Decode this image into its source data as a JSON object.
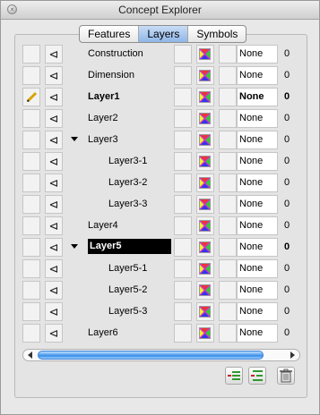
{
  "window": {
    "title": "Concept Explorer",
    "close_glyph": "×"
  },
  "tabs": [
    {
      "label": "Features",
      "active": false
    },
    {
      "label": "Layers",
      "active": true
    },
    {
      "label": "Symbols",
      "active": false
    }
  ],
  "layers": [
    {
      "name": "Construction",
      "indent": 0,
      "bold": false,
      "selected": false,
      "current": false,
      "expanded": null,
      "linetype": "None",
      "count": "0"
    },
    {
      "name": "Dimension",
      "indent": 0,
      "bold": false,
      "selected": false,
      "current": false,
      "expanded": null,
      "linetype": "None",
      "count": "0"
    },
    {
      "name": "Layer1",
      "indent": 0,
      "bold": true,
      "selected": false,
      "current": true,
      "expanded": null,
      "linetype": "None",
      "count": "0"
    },
    {
      "name": "Layer2",
      "indent": 0,
      "bold": false,
      "selected": false,
      "current": false,
      "expanded": null,
      "linetype": "None",
      "count": "0"
    },
    {
      "name": "Layer3",
      "indent": 0,
      "bold": false,
      "selected": false,
      "current": false,
      "expanded": true,
      "linetype": "None",
      "count": "0"
    },
    {
      "name": "Layer3-1",
      "indent": 1,
      "bold": false,
      "selected": false,
      "current": false,
      "expanded": null,
      "linetype": "None",
      "count": "0"
    },
    {
      "name": "Layer3-2",
      "indent": 1,
      "bold": false,
      "selected": false,
      "current": false,
      "expanded": null,
      "linetype": "None",
      "count": "0"
    },
    {
      "name": "Layer3-3",
      "indent": 1,
      "bold": false,
      "selected": false,
      "current": false,
      "expanded": null,
      "linetype": "None",
      "count": "0"
    },
    {
      "name": "Layer4",
      "indent": 0,
      "bold": false,
      "selected": false,
      "current": false,
      "expanded": null,
      "linetype": "None",
      "count": "0"
    },
    {
      "name": "Layer5",
      "indent": 0,
      "bold": true,
      "selected": true,
      "current": false,
      "expanded": true,
      "linetype": "None",
      "count": "0"
    },
    {
      "name": "Layer5-1",
      "indent": 1,
      "bold": false,
      "selected": false,
      "current": false,
      "expanded": null,
      "linetype": "None",
      "count": "0"
    },
    {
      "name": "Layer5-2",
      "indent": 1,
      "bold": false,
      "selected": false,
      "current": false,
      "expanded": null,
      "linetype": "None",
      "count": "0"
    },
    {
      "name": "Layer5-3",
      "indent": 1,
      "bold": false,
      "selected": false,
      "current": false,
      "expanded": null,
      "linetype": "None",
      "count": "0"
    },
    {
      "name": "Layer6",
      "indent": 0,
      "bold": false,
      "selected": false,
      "current": false,
      "expanded": null,
      "linetype": "None",
      "count": "0"
    }
  ],
  "icons": {
    "visibility": "arrow-eye-icon",
    "color": "color-swatch-icon",
    "current": "pencil-icon",
    "add_layer": "add-layer-icon",
    "add_sublayer": "add-sublayer-icon",
    "delete": "trash-icon"
  },
  "colors": {
    "selection_bg": "#000000",
    "scroll_thumb": "#3a8ee8",
    "tab_active": "#8fb7e8"
  }
}
